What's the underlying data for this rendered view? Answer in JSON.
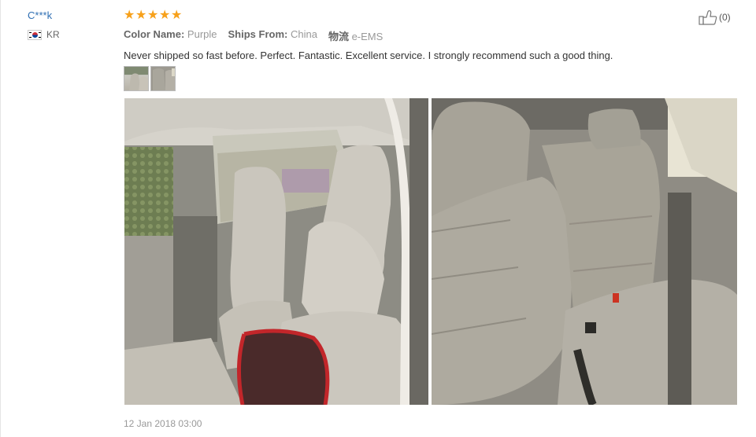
{
  "reviewer": {
    "name": "C***k",
    "country": "KR"
  },
  "rating": {
    "value": 5,
    "max": 5,
    "star_glyph": "★",
    "color": "#f7a11b"
  },
  "attributes": {
    "color_label": "Color Name:",
    "color_value": "Purple",
    "ships_label": "Ships From:",
    "ships_value": "China",
    "logistics_label": "物流",
    "logistics_value": "e-EMS"
  },
  "review": {
    "text": "Never shipped so fast before. Perfect. Fantastic. Excellent service. I strongly recommend such a good thing."
  },
  "helpful": {
    "count": "(0)",
    "icon": "thumbs-up-icon"
  },
  "date": "12 Jan 2018 03:00"
}
